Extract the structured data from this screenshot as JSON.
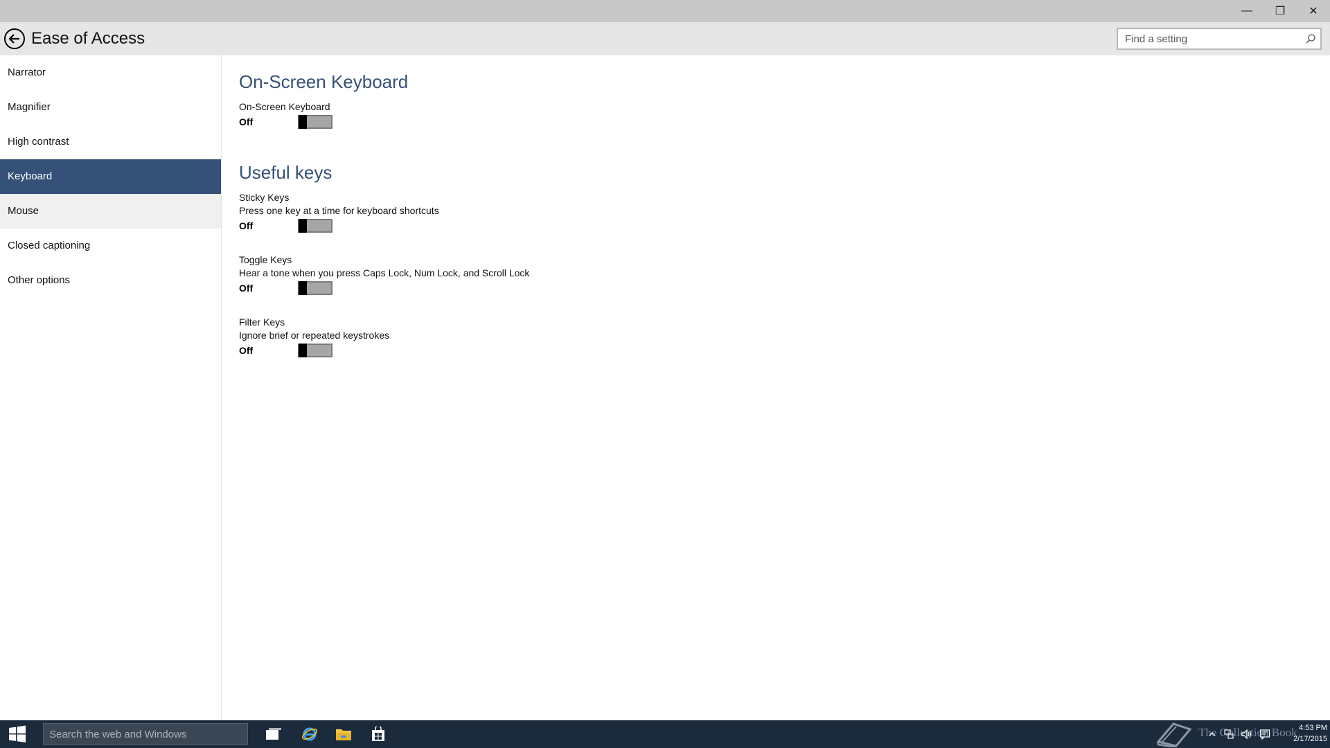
{
  "window": {
    "minimize_glyph": "—",
    "maximize_glyph": "❐",
    "close_glyph": "✕"
  },
  "header": {
    "title": "Ease of Access",
    "search_placeholder": "Find a setting"
  },
  "sidebar": {
    "items": [
      {
        "label": "Narrator"
      },
      {
        "label": "Magnifier"
      },
      {
        "label": "High contrast"
      },
      {
        "label": "Keyboard",
        "selected": true
      },
      {
        "label": "Mouse"
      },
      {
        "label": "Closed captioning"
      },
      {
        "label": "Other options"
      }
    ]
  },
  "content": {
    "osk_section": {
      "title": "On-Screen Keyboard",
      "setting": {
        "label": "On-Screen Keyboard",
        "state": "Off"
      }
    },
    "useful_keys": {
      "title": "Useful keys",
      "sticky": {
        "label": "Sticky Keys",
        "desc": "Press one key at a time for keyboard shortcuts",
        "state": "Off"
      },
      "toggle": {
        "label": "Toggle Keys",
        "desc": "Hear a tone when you press Caps Lock, Num Lock, and Scroll Lock",
        "state": "Off"
      },
      "filter": {
        "label": "Filter Keys",
        "desc": "Ignore brief or repeated keystrokes",
        "state": "Off"
      }
    }
  },
  "taskbar": {
    "search_placeholder": "Search the web and Windows",
    "watermark": "The Collection Book",
    "time": "4:53 PM",
    "date": "2/17/2015"
  },
  "colors": {
    "accent": "#355177",
    "taskbar": "#1c2b3c",
    "titlebar": "#c8c8c8",
    "header": "#e6e6e6"
  }
}
